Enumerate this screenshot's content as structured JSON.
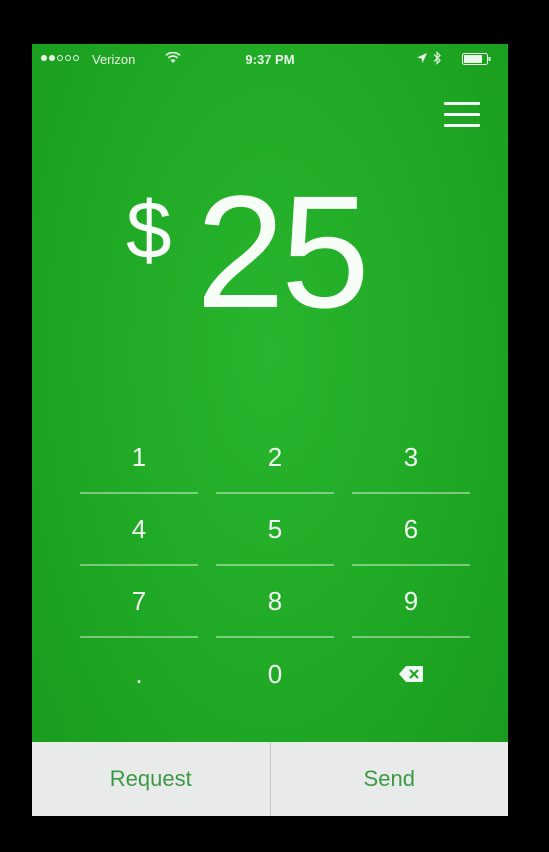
{
  "status_bar": {
    "signal_bars_filled": 2,
    "signal_bars_total": 5,
    "carrier": "Verizon",
    "time": "9:37 PM",
    "icons": [
      "wifi-icon",
      "location-icon",
      "bluetooth-icon",
      "battery-icon"
    ]
  },
  "header": {
    "menu_icon": "hamburger-menu-icon"
  },
  "amount": {
    "currency_symbol": "$",
    "value": "25"
  },
  "keypad": {
    "keys": [
      "1",
      "2",
      "3",
      "4",
      "5",
      "6",
      "7",
      "8",
      "9",
      ".",
      "0"
    ],
    "backspace_icon": "backspace-icon"
  },
  "actions": {
    "request_label": "Request",
    "send_label": "Send"
  },
  "colors": {
    "background": "#1fa824",
    "action_bar": "#e9ebea",
    "action_text": "#3a9a45"
  }
}
